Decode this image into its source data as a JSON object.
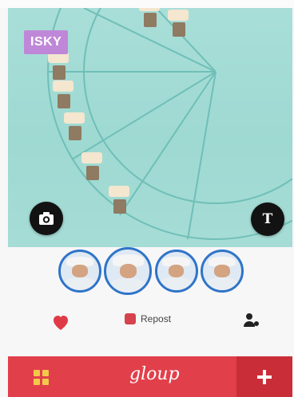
{
  "hero": {
    "tag": "ISKY"
  },
  "actions": {
    "repost_label": "Repost"
  },
  "bar": {
    "brand": "gloup"
  },
  "colors": {
    "accent": "#e1404b",
    "accent_dark": "#c92e38",
    "tag": "#bf87d8",
    "sky": "#9ed9d2",
    "avatar_ring": "#2f74c8",
    "grid_icon": "#f4c84b"
  },
  "icons": {
    "camera": "camera-icon",
    "text": "text-icon",
    "heart": "heart-icon",
    "repost": "repost-icon",
    "user": "user-icon",
    "grid": "grid-icon",
    "plus": "plus-icon"
  }
}
